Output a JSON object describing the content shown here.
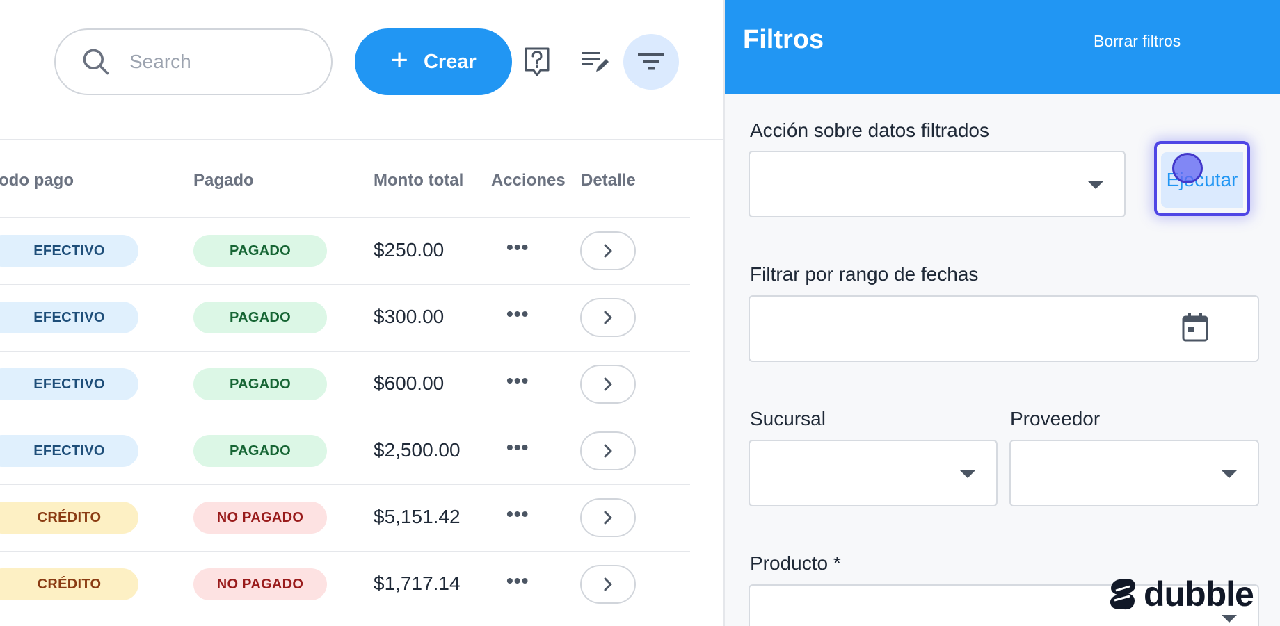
{
  "toolbar": {
    "search_placeholder": "Search",
    "create_label": "Crear"
  },
  "table": {
    "columns": [
      "odo pago",
      "Pagado",
      "Monto total",
      "Acciones",
      "Detalle"
    ],
    "rows": [
      {
        "method": "EFECTIVO",
        "paid": "PAGADO",
        "amount": "$250.00"
      },
      {
        "method": "EFECTIVO",
        "paid": "PAGADO",
        "amount": "$300.00"
      },
      {
        "method": "EFECTIVO",
        "paid": "PAGADO",
        "amount": "$600.00"
      },
      {
        "method": "EFECTIVO",
        "paid": "PAGADO",
        "amount": "$2,500.00"
      },
      {
        "method": "CRÉDITO",
        "paid": "NO PAGADO",
        "amount": "$5,151.42"
      },
      {
        "method": "CRÉDITO",
        "paid": "NO PAGADO",
        "amount": "$1,717.14"
      }
    ],
    "actions_glyph": "•••"
  },
  "filters": {
    "title": "Filtros",
    "clear_label": "Borrar filtros",
    "action_label": "Acción sobre datos filtrados",
    "execute_label": "Ejecutar",
    "date_range_label": "Filtrar por rango de fechas",
    "branch_label": "Sucursal",
    "supplier_label": "Proveedor",
    "product_label": "Producto *"
  },
  "brand": {
    "name": "dubble"
  },
  "colors": {
    "primary": "#2196f3",
    "focus_ring": "#4f46e5"
  }
}
